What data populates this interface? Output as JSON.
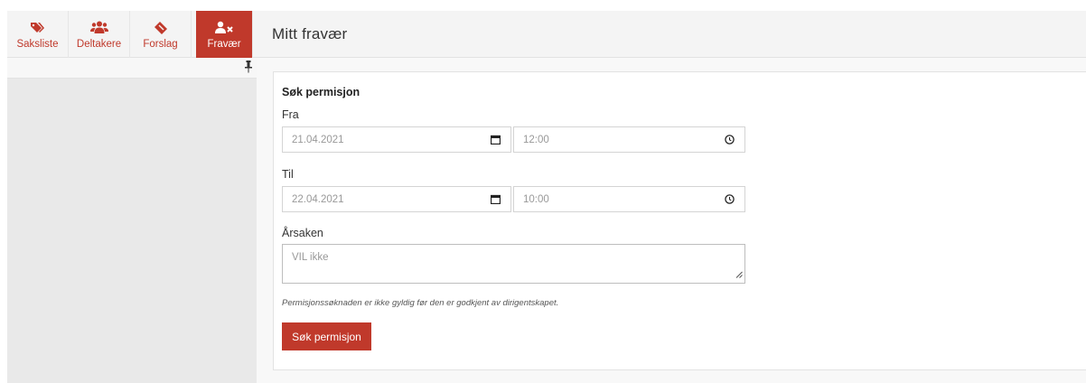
{
  "nav": {
    "items": [
      {
        "label": "Saksliste",
        "icon": "tags-icon"
      },
      {
        "label": "Deltakere",
        "icon": "users-icon"
      },
      {
        "label": "Forslag",
        "icon": "ticket-icon"
      },
      {
        "label": "Fravær",
        "icon": "user-times-icon",
        "active": true
      }
    ]
  },
  "header": {
    "title": "Mitt fravær"
  },
  "form": {
    "title": "Søk permisjon",
    "from_label": "Fra",
    "from_date": "21.04.2021",
    "from_time": "12:00",
    "to_label": "Til",
    "to_date": "22.04.2021",
    "to_time": "10:00",
    "reason_label": "Årsaken",
    "reason_value": "VIL ikke",
    "hint": "Permisjonssøknaden er ikke gyldig før den er godkjent av dirigentskapet.",
    "submit_label": "Søk permisjon"
  },
  "colors": {
    "accent": "#c0392b",
    "sidebar_bg": "#e9e9e9",
    "bar_bg": "#f4f4f4"
  }
}
